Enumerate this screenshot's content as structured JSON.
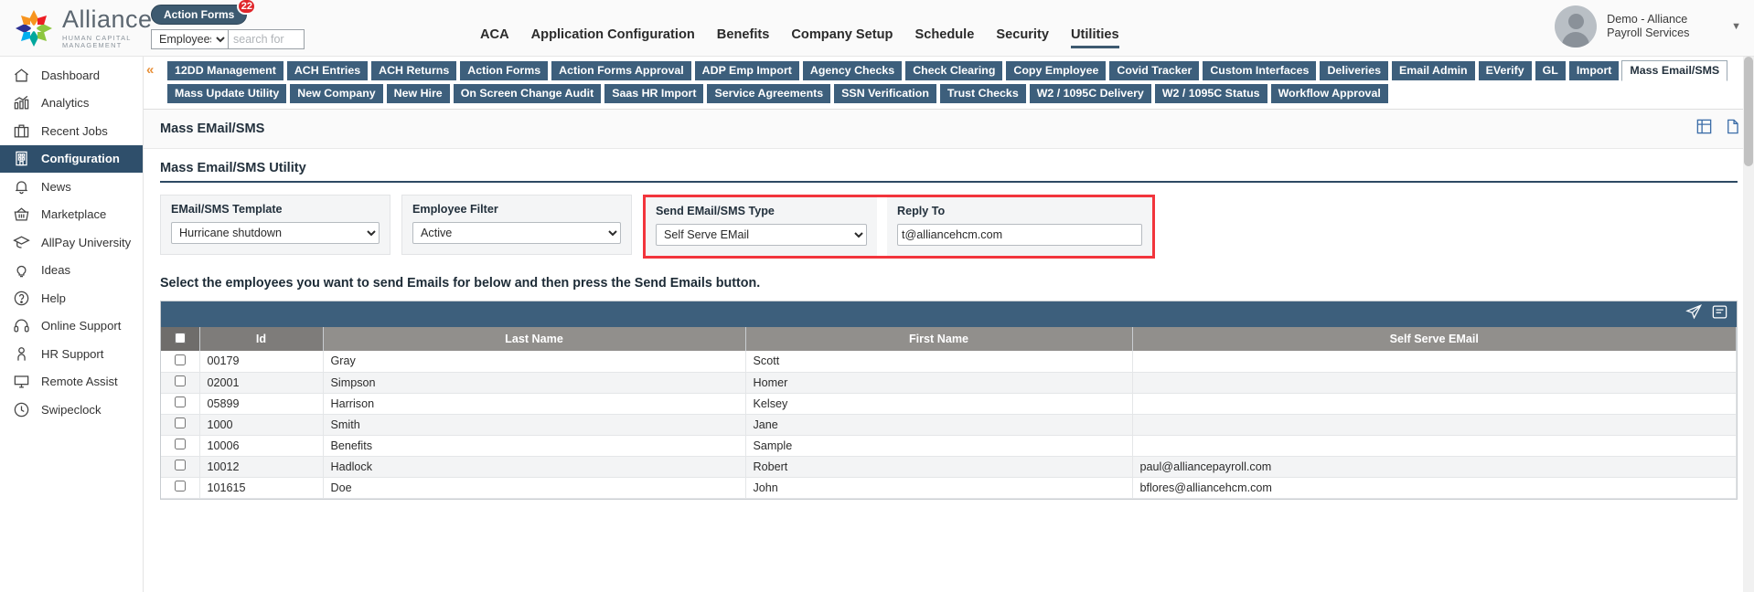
{
  "brand": {
    "name": "Alliance",
    "tagline": "HUMAN CAPITAL MANAGEMENT"
  },
  "topbar": {
    "action_forms_label": "Action Forms",
    "action_forms_badge": "22",
    "entity_select": "Employees",
    "search_placeholder": "search for",
    "menu": [
      {
        "label": "ACA",
        "active": false
      },
      {
        "label": "Application Configuration",
        "active": false
      },
      {
        "label": "Benefits",
        "active": false
      },
      {
        "label": "Company Setup",
        "active": false
      },
      {
        "label": "Schedule",
        "active": false
      },
      {
        "label": "Security",
        "active": false
      },
      {
        "label": "Utilities",
        "active": true
      }
    ],
    "profile_name": "Demo - Alliance Payroll Services"
  },
  "sidebar": {
    "items": [
      {
        "label": "Dashboard",
        "icon": "home-icon",
        "active": false
      },
      {
        "label": "Analytics",
        "icon": "analytics-icon",
        "active": false
      },
      {
        "label": "Recent Jobs",
        "icon": "briefcase-icon",
        "active": false
      },
      {
        "label": "Configuration",
        "icon": "building-icon",
        "active": true
      },
      {
        "label": "News",
        "icon": "bell-icon",
        "active": false
      },
      {
        "label": "Marketplace",
        "icon": "basket-icon",
        "active": false
      },
      {
        "label": "AllPay University",
        "icon": "graduation-cap-icon",
        "active": false
      },
      {
        "label": "Ideas",
        "icon": "lightbulb-icon",
        "active": false
      },
      {
        "label": "Help",
        "icon": "question-circle-icon",
        "active": false
      },
      {
        "label": "Online Support",
        "icon": "headset-icon",
        "active": false
      },
      {
        "label": "HR Support",
        "icon": "person-icon",
        "active": false
      },
      {
        "label": "Remote Assist",
        "icon": "monitor-icon",
        "active": false
      },
      {
        "label": "Swipeclock",
        "icon": "clock-icon",
        "active": false
      }
    ]
  },
  "tabs": {
    "row1": [
      {
        "label": "12DD Management",
        "active": false
      },
      {
        "label": "ACH Entries",
        "active": false
      },
      {
        "label": "ACH Returns",
        "active": false
      },
      {
        "label": "Action Forms",
        "active": false
      },
      {
        "label": "Action Forms Approval",
        "active": false
      },
      {
        "label": "ADP Emp Import",
        "active": false
      },
      {
        "label": "Agency Checks",
        "active": false
      },
      {
        "label": "Check Clearing",
        "active": false
      },
      {
        "label": "Copy Employee",
        "active": false
      },
      {
        "label": "Covid Tracker",
        "active": false
      },
      {
        "label": "Custom Interfaces",
        "active": false
      },
      {
        "label": "Deliveries",
        "active": false
      },
      {
        "label": "Email Admin",
        "active": false
      },
      {
        "label": "EVerify",
        "active": false
      },
      {
        "label": "GL",
        "active": false
      },
      {
        "label": "Import",
        "active": false
      },
      {
        "label": "Mass Email/SMS",
        "active": true
      }
    ],
    "row2": [
      {
        "label": "Mass Update Utility",
        "active": false
      },
      {
        "label": "New Company",
        "active": false
      },
      {
        "label": "New Hire",
        "active": false
      },
      {
        "label": "On Screen Change Audit",
        "active": false
      },
      {
        "label": "Saas HR Import",
        "active": false
      },
      {
        "label": "Service Agreements",
        "active": false
      },
      {
        "label": "SSN Verification",
        "active": false
      },
      {
        "label": "Trust Checks",
        "active": false
      },
      {
        "label": "W2 / 1095C Delivery",
        "active": false
      },
      {
        "label": "W2 / 1095C Status",
        "active": false
      },
      {
        "label": "Workflow Approval",
        "active": false
      }
    ]
  },
  "page": {
    "title": "Mass EMail/SMS",
    "panel_title": "Mass Email/SMS Utility",
    "instruction": "Select the employees you want to send Emails for below and then press the Send Emails button."
  },
  "form": {
    "template": {
      "label": "EMail/SMS Template",
      "value": "Hurricane shutdown"
    },
    "employee_filter": {
      "label": "Employee Filter",
      "value": "Active"
    },
    "send_type": {
      "label": "Send EMail/SMS Type",
      "value": "Self Serve EMail"
    },
    "reply_to": {
      "label": "Reply To",
      "value": "t@alliancehcm.com"
    },
    "highlight_color": "#f2353c"
  },
  "table": {
    "columns": [
      "",
      "Id",
      "Last Name",
      "First Name",
      "Self Serve EMail"
    ],
    "rows": [
      {
        "id": "00179",
        "last": "Gray",
        "first": "Scott",
        "email": ""
      },
      {
        "id": "02001",
        "last": "Simpson",
        "first": "Homer",
        "email": ""
      },
      {
        "id": "05899",
        "last": "Harrison",
        "first": "Kelsey",
        "email": ""
      },
      {
        "id": "1000",
        "last": "Smith",
        "first": "Jane",
        "email": ""
      },
      {
        "id": "10006",
        "last": "Benefits",
        "first": "Sample",
        "email": ""
      },
      {
        "id": "10012",
        "last": "Hadlock",
        "first": "Robert",
        "email": "paul@alliancepayroll.com"
      },
      {
        "id": "101615",
        "last": "Doe",
        "first": "John",
        "email": "bflores@alliancehcm.com"
      }
    ]
  }
}
